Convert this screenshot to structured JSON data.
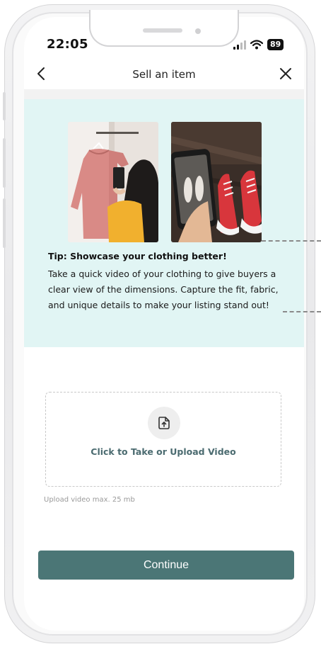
{
  "status_bar": {
    "time": "22:05",
    "battery": "89",
    "icons": [
      "signal-icon",
      "wifi-icon",
      "battery-icon"
    ]
  },
  "nav": {
    "title": "Sell an item",
    "back_icon": "chevron-left-icon",
    "close_icon": "close-icon"
  },
  "tip": {
    "title": "Tip: Showcase your clothing better!",
    "body": "Take a quick video of your clothing to give buyers a clear view of the dimensions. Capture the fit, fabric, and unique details to make your listing stand out!",
    "background_color": "#e1f5f4"
  },
  "upload": {
    "label": "Click to Take or Upload Video",
    "hint": "Upload video max. 25 mb",
    "icon": "upload-file-icon"
  },
  "actions": {
    "continue_label": "Continue",
    "continue_color": "#4b7676"
  }
}
